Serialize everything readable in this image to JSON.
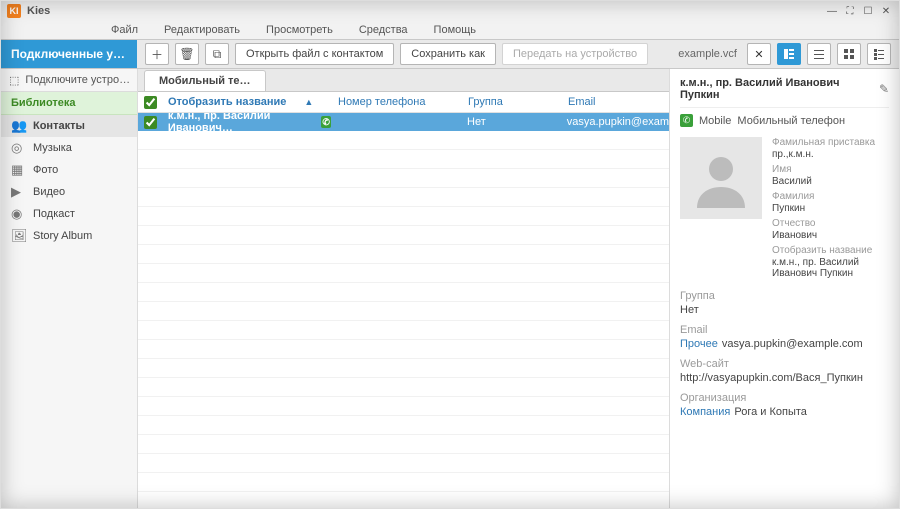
{
  "app": {
    "title": "Kies",
    "logo_text": "KI"
  },
  "menu": {
    "file": "Файл",
    "edit": "Редактировать",
    "view": "Просмотреть",
    "tools": "Средства",
    "help": "Помощь"
  },
  "window_controls": {
    "minimize": "—",
    "expand": "⛶",
    "maximize": "☐",
    "close": "✕"
  },
  "devices_header": "Подключенные у…",
  "toolbar": {
    "open_label": "Открыть файл с контактом",
    "save_as_label": "Сохранить как",
    "send_device_label": "Передать на устройство",
    "filename": "example.vcf"
  },
  "sidebar": {
    "connect_label": "Подключите устро…",
    "library_label": "Библиотека",
    "items": [
      {
        "label": "Контакты",
        "glyph": "👥",
        "active": true
      },
      {
        "label": "Музыка",
        "glyph": "◎",
        "active": false
      },
      {
        "label": "Фото",
        "glyph": "▦",
        "active": false
      },
      {
        "label": "Видео",
        "glyph": "▶",
        "active": false
      },
      {
        "label": "Подкаст",
        "glyph": "◉",
        "active": false
      },
      {
        "label": "Story Album",
        "glyph": "🖼",
        "active": false
      }
    ]
  },
  "tabs": {
    "active": "Мобильный те…"
  },
  "table": {
    "headers": {
      "name": "Отобразить название",
      "phone": "Номер телефона",
      "group": "Группа",
      "email": "Email"
    },
    "rows": [
      {
        "name": "к.м.н., пр. Василий Иванович…",
        "phone": "",
        "group": "Нет",
        "email": "vasya.pupkin@exam"
      }
    ]
  },
  "detail": {
    "full_name": "к.м.н., пр. Василий Иванович Пупкин",
    "mobile_label": "Mobile",
    "mobile_value": "Мобильный телефон",
    "fields": {
      "prefix_label": "Фамильная приставка",
      "prefix_value": "пр.,к.м.н.",
      "first_label": "Имя",
      "first_value": "Василий",
      "last_label": "Фамилия",
      "last_value": "Пупкин",
      "middle_label": "Отчество",
      "middle_value": "Иванович",
      "display_label": "Отобразить название",
      "display_value": "к.м.н., пр. Василий Иванович Пупкин"
    },
    "group_label": "Группа",
    "group_value": "Нет",
    "email_label": "Email",
    "email_kind": "Прочее",
    "email_value": "vasya.pupkin@example.com",
    "web_label": "Web-сайт",
    "web_value": "http://vasyapupkin.com/Вася_Пупкин",
    "org_label": "Организация",
    "org_kind": "Компания",
    "org_value": "Рога и Копыта"
  }
}
